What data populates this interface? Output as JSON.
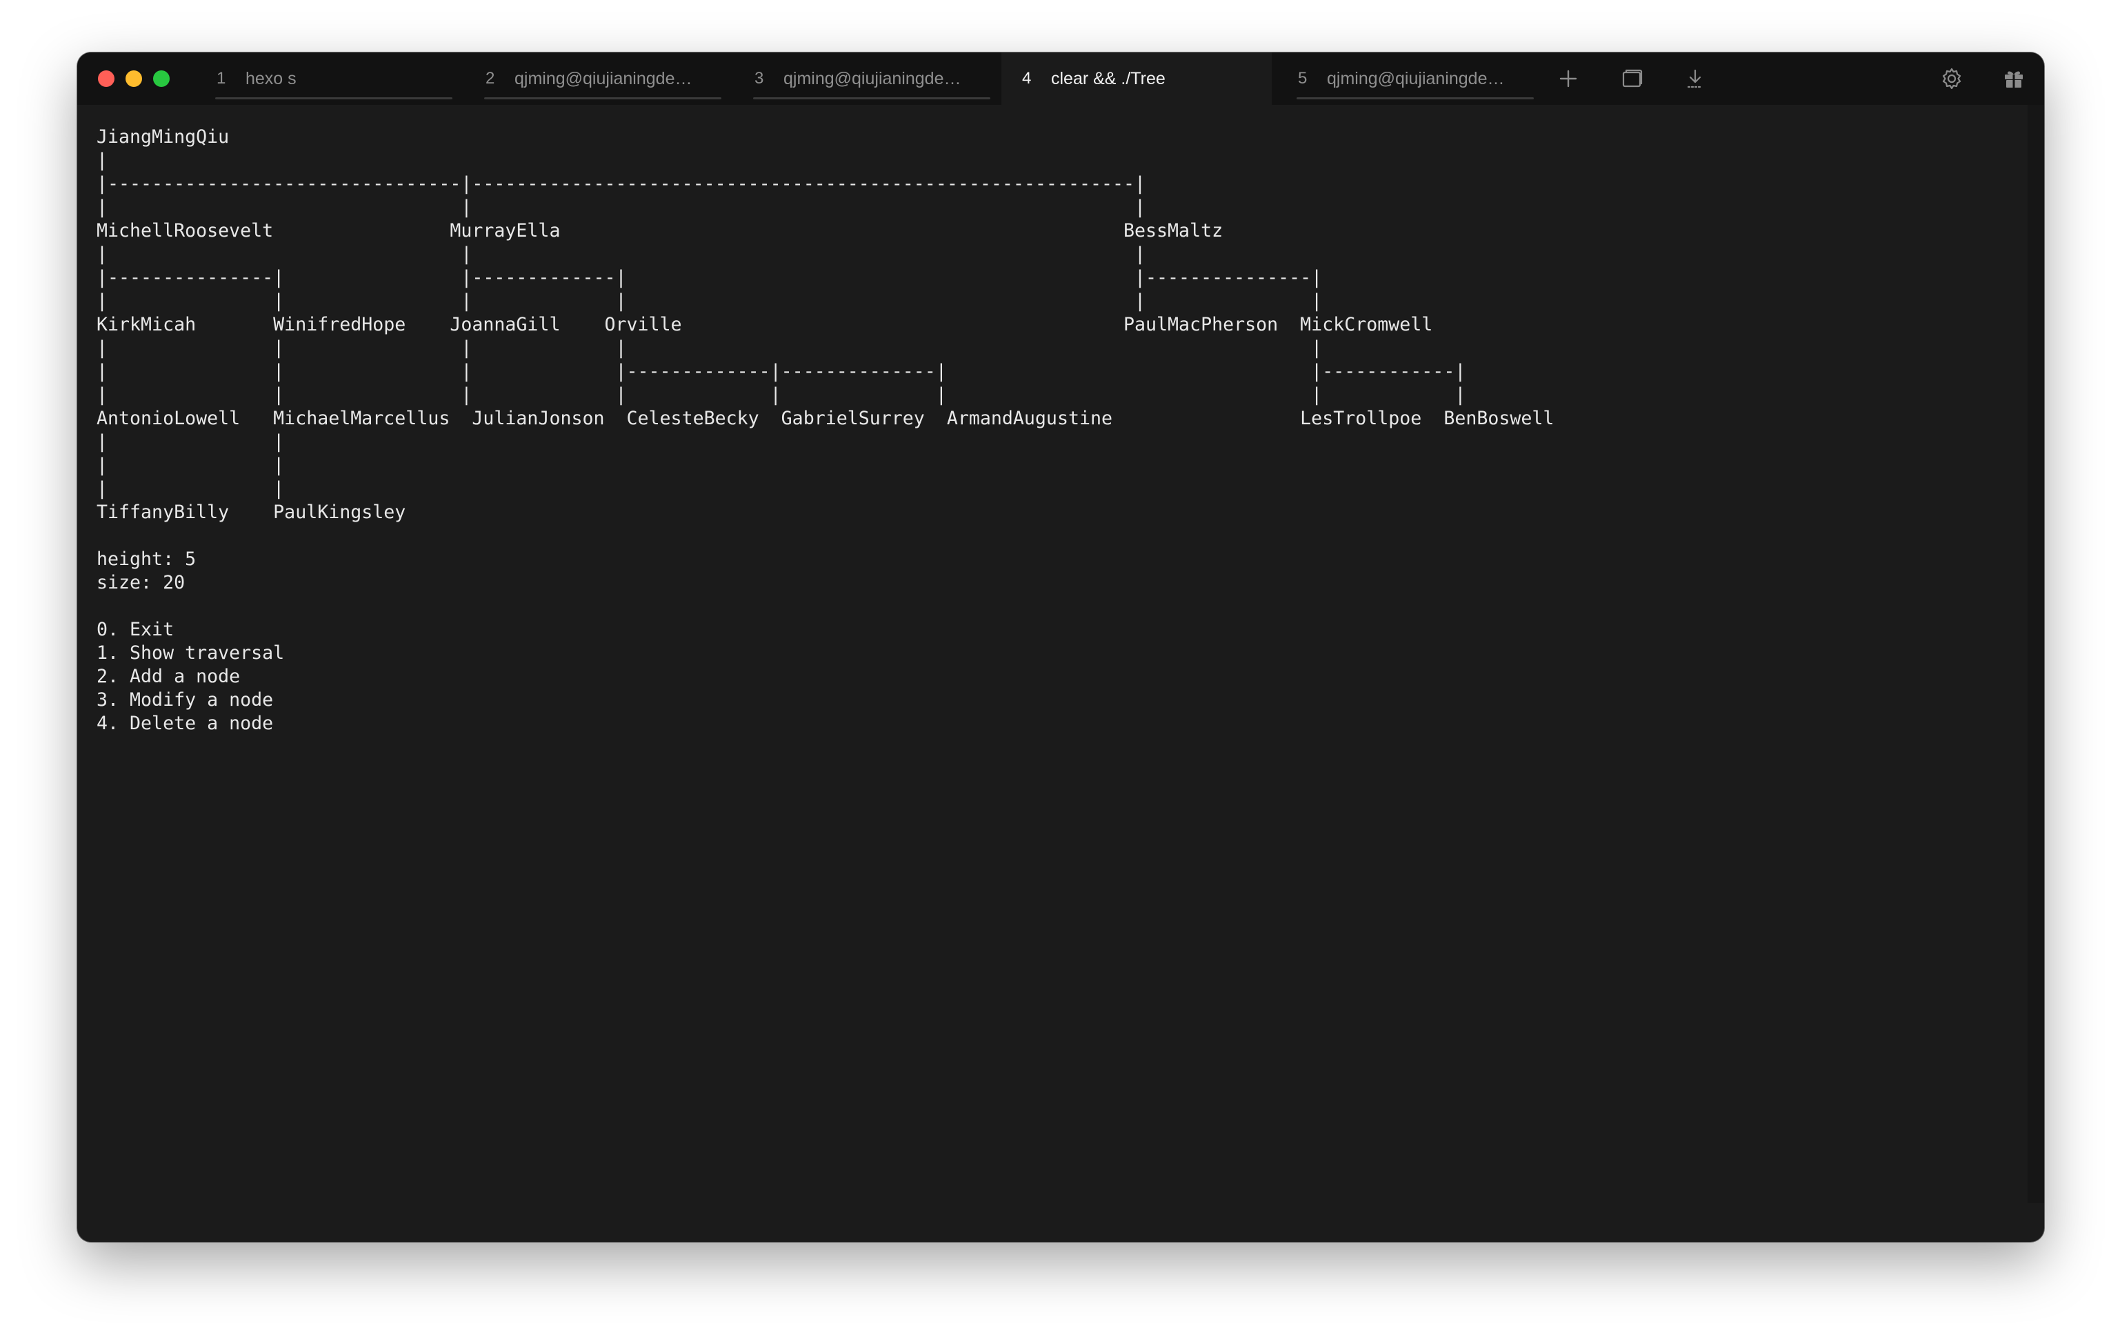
{
  "window": {
    "tabs": [
      {
        "number": "1",
        "title": "hexo s",
        "active": false
      },
      {
        "number": "2",
        "title": "qjming@qiujianingde…",
        "active": false
      },
      {
        "number": "3",
        "title": "qjming@qiujianingde…",
        "active": false
      },
      {
        "number": "4",
        "title": "clear && ./Tree",
        "active": true
      },
      {
        "number": "5",
        "title": "qjming@qiujianingde…",
        "active": false
      }
    ],
    "toolbar_icons": [
      "plus-icon",
      "split-pane-icon",
      "download-icon",
      "gear-icon",
      "gift-icon"
    ]
  },
  "terminal": {
    "output": "JiangMingQiu\n|\n|--------------------------------|------------------------------------------------------------|\n|                                |                                                            |\nMichellRoosevelt                MurrayElla                                                   BessMaltz\n|                                |                                                            |\n|---------------|                |-------------|                                              |---------------|\n|               |                |             |                                              |               |\nKirkMicah       WinifredHope    JoannaGill    Orville                                        PaulMacPherson  MickCromwell\n|               |                |             |                                                              |\n|               |                |             |-------------|--------------|                                 |------------|\n|               |                |             |             |              |                                 |            |\nAntonioLowell   MichaelMarcellus  JulianJonson  CelesteBecky  GabrielSurrey  ArmandAugustine                 LesTrollpoe  BenBoswell\n|               |\n|               |\n|               |\nTiffanyBilly    PaulKingsley\n\nheight: 5\nsize: 20\n\n0. Exit\n1. Show traversal\n2. Add a node\n3. Modify a node\n4. Delete a node"
  },
  "colors": {
    "window_bg": "#1b1b1b",
    "titlebar_bg": "#121212",
    "text": "#e8e8e8",
    "traffic_red": "#ff5f57",
    "traffic_yellow": "#febc2e",
    "traffic_green": "#28c840"
  }
}
